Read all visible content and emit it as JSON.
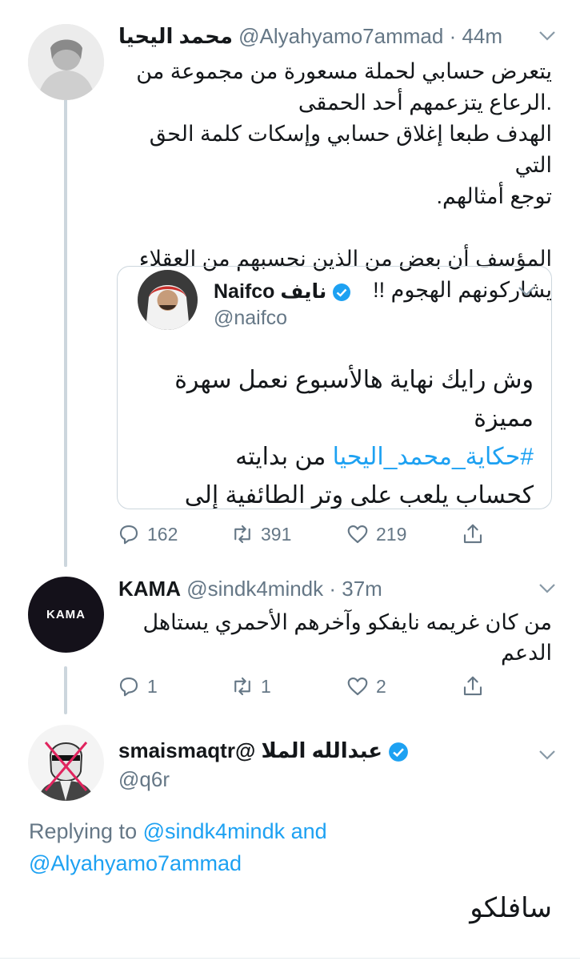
{
  "tweet1": {
    "name": "محمد اليحيا",
    "handle": "@Alyahyamo7ammad",
    "time": "· 44m",
    "lines": [
      "يتعرض حسابي لحملة مسعورة من مجموعة من",
      ".الرعاع يتزعمهم أحد الحمقى",
      "الهدف طبعا إغلاق حسابي وإسكات كلمة الحق التي",
      "توجع أمثالهم."
    ],
    "lines2": [
      "المؤسف أن بعض من الذين نحسبهم من العقلاء",
      "يشاركونهم الهجوم !!"
    ],
    "quote": {
      "name": "Naifco نايف",
      "handle": "@naifco",
      "line1": "وش رايك نهاية هالأسبوع نعمل سهرة",
      "line2": "مميزة",
      "hashtag": "#حكاية_محمد_اليحيا",
      "hashtag_suffix": "من بدايته",
      "line4": "كحساب يلعب على وتر الطائفية إلى"
    },
    "replies": "162",
    "retweets": "391",
    "likes": "219"
  },
  "tweet2": {
    "name": "KAMA",
    "handle": "@sindk4mindk",
    "time": "· 37m",
    "avatar_text": "KAMA",
    "lines": [
      "من كان غريمه نايفكو وآخرهم الأحمري يستاهل",
      "الدعم"
    ],
    "replies": "1",
    "retweets": "1",
    "likes": "2"
  },
  "tweet3": {
    "name": "smaismaqtr@ عبدالله الملا",
    "handle": "@q6r",
    "replying_prefix": "Replying to",
    "replying_user1": "@sindk4mindk",
    "replying_and": "and",
    "replying_user2": "@Alyahyamo7ammad",
    "body": "سافلكو"
  },
  "icons": {
    "reply": "reply-icon",
    "retweet": "retweet-icon",
    "like": "heart-icon",
    "share": "share-icon",
    "chevron": "chevron-down-icon",
    "verified": "verified-badge-icon"
  },
  "colors": {
    "link": "#1da1f2",
    "muted": "#657786",
    "line": "#ccd6dd",
    "verified": "#1da1f2"
  }
}
